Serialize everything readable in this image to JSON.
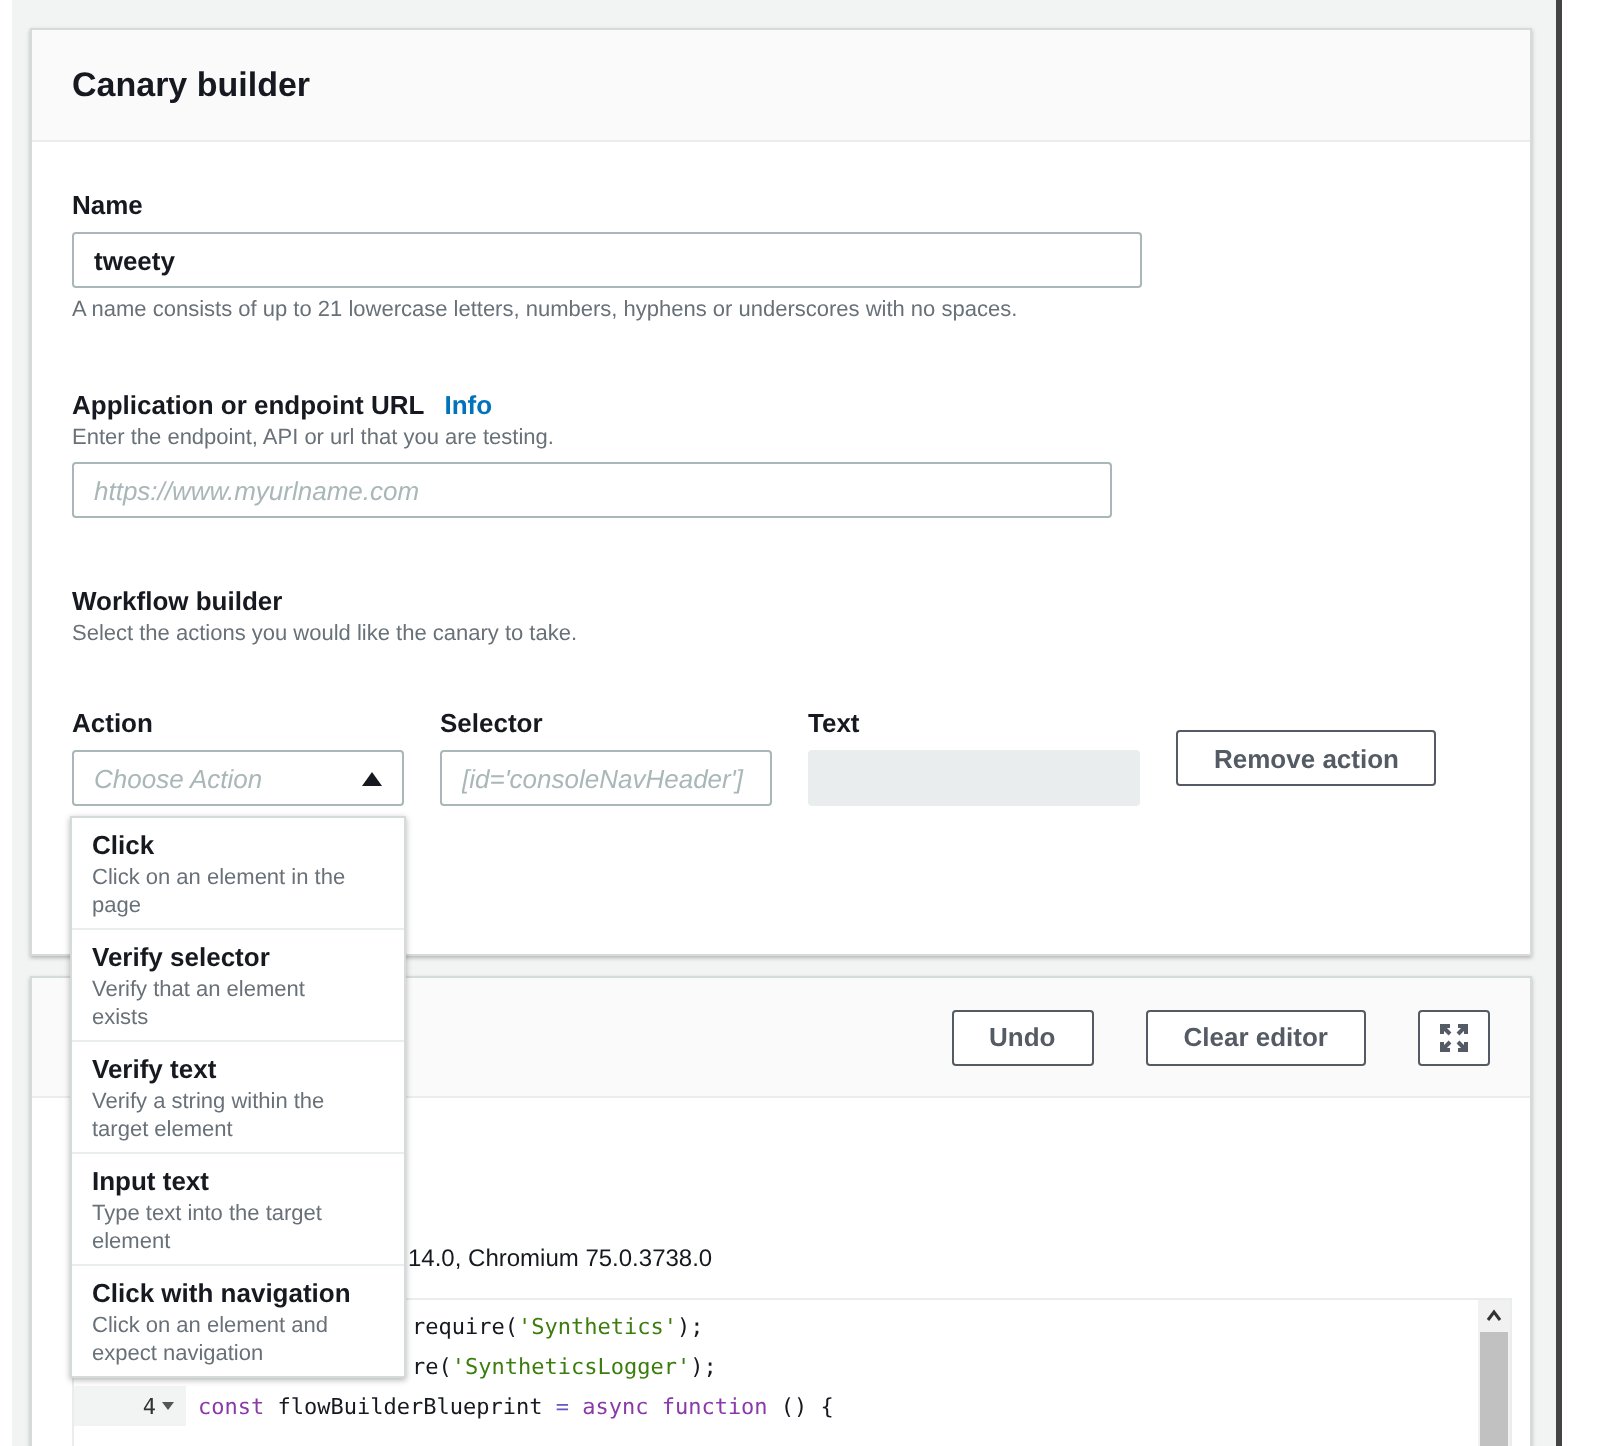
{
  "panel": {
    "title": "Canary builder"
  },
  "name_field": {
    "label": "Name",
    "value": "tweety",
    "hint": "A name consists of up to 21 lowercase letters, numbers, hyphens or underscores with no spaces."
  },
  "url_field": {
    "label": "Application or endpoint URL",
    "info_link": "Info",
    "description": "Enter the endpoint, API or url that you are testing.",
    "placeholder": "https://www.myurlname.com"
  },
  "workflow": {
    "title": "Workflow builder",
    "description": "Select the actions you would like the canary to take.",
    "action": {
      "label": "Action",
      "placeholder": "Choose Action",
      "expanded": true,
      "options": [
        {
          "title": "Click",
          "description": "Click on an element in the page"
        },
        {
          "title": "Verify selector",
          "description": "Verify that an element exists"
        },
        {
          "title": "Verify text",
          "description": "Verify a string within the target element"
        },
        {
          "title": "Input text",
          "description": "Type text into the target element"
        },
        {
          "title": "Click with navigation",
          "description": "Click on an element and expect navigation"
        }
      ]
    },
    "selector": {
      "label": "Selector",
      "placeholder": "[id='consoleNavHeader']"
    },
    "text": {
      "label": "Text",
      "disabled": true
    },
    "remove_button": "Remove action"
  },
  "editor": {
    "buttons": [
      "Undo",
      "Clear editor"
    ],
    "runtime": "14.0, Chromium 75.0.3738.0",
    "code_lines": [
      {
        "tokens": [
          {
            "text": "require(",
            "kind": "plain"
          },
          {
            "text": "'Synthetics'",
            "kind": "string"
          },
          {
            "text": ");",
            "kind": "plain"
          }
        ]
      },
      {
        "tokens": [
          {
            "text": "re(",
            "kind": "plain"
          },
          {
            "text": "'SyntheticsLogger'",
            "kind": "string"
          },
          {
            "text": ");",
            "kind": "plain"
          }
        ]
      },
      {
        "number": "4",
        "foldable": true,
        "tokens": [
          {
            "text": "const",
            "kind": "keyword"
          },
          {
            "text": " flowBuilderBlueprint ",
            "kind": "plain"
          },
          {
            "text": "=",
            "kind": "operator"
          },
          {
            "text": " async",
            "kind": "keyword"
          },
          {
            "text": " function",
            "kind": "keyword"
          },
          {
            "text": " () {",
            "kind": "plain"
          }
        ]
      }
    ]
  }
}
